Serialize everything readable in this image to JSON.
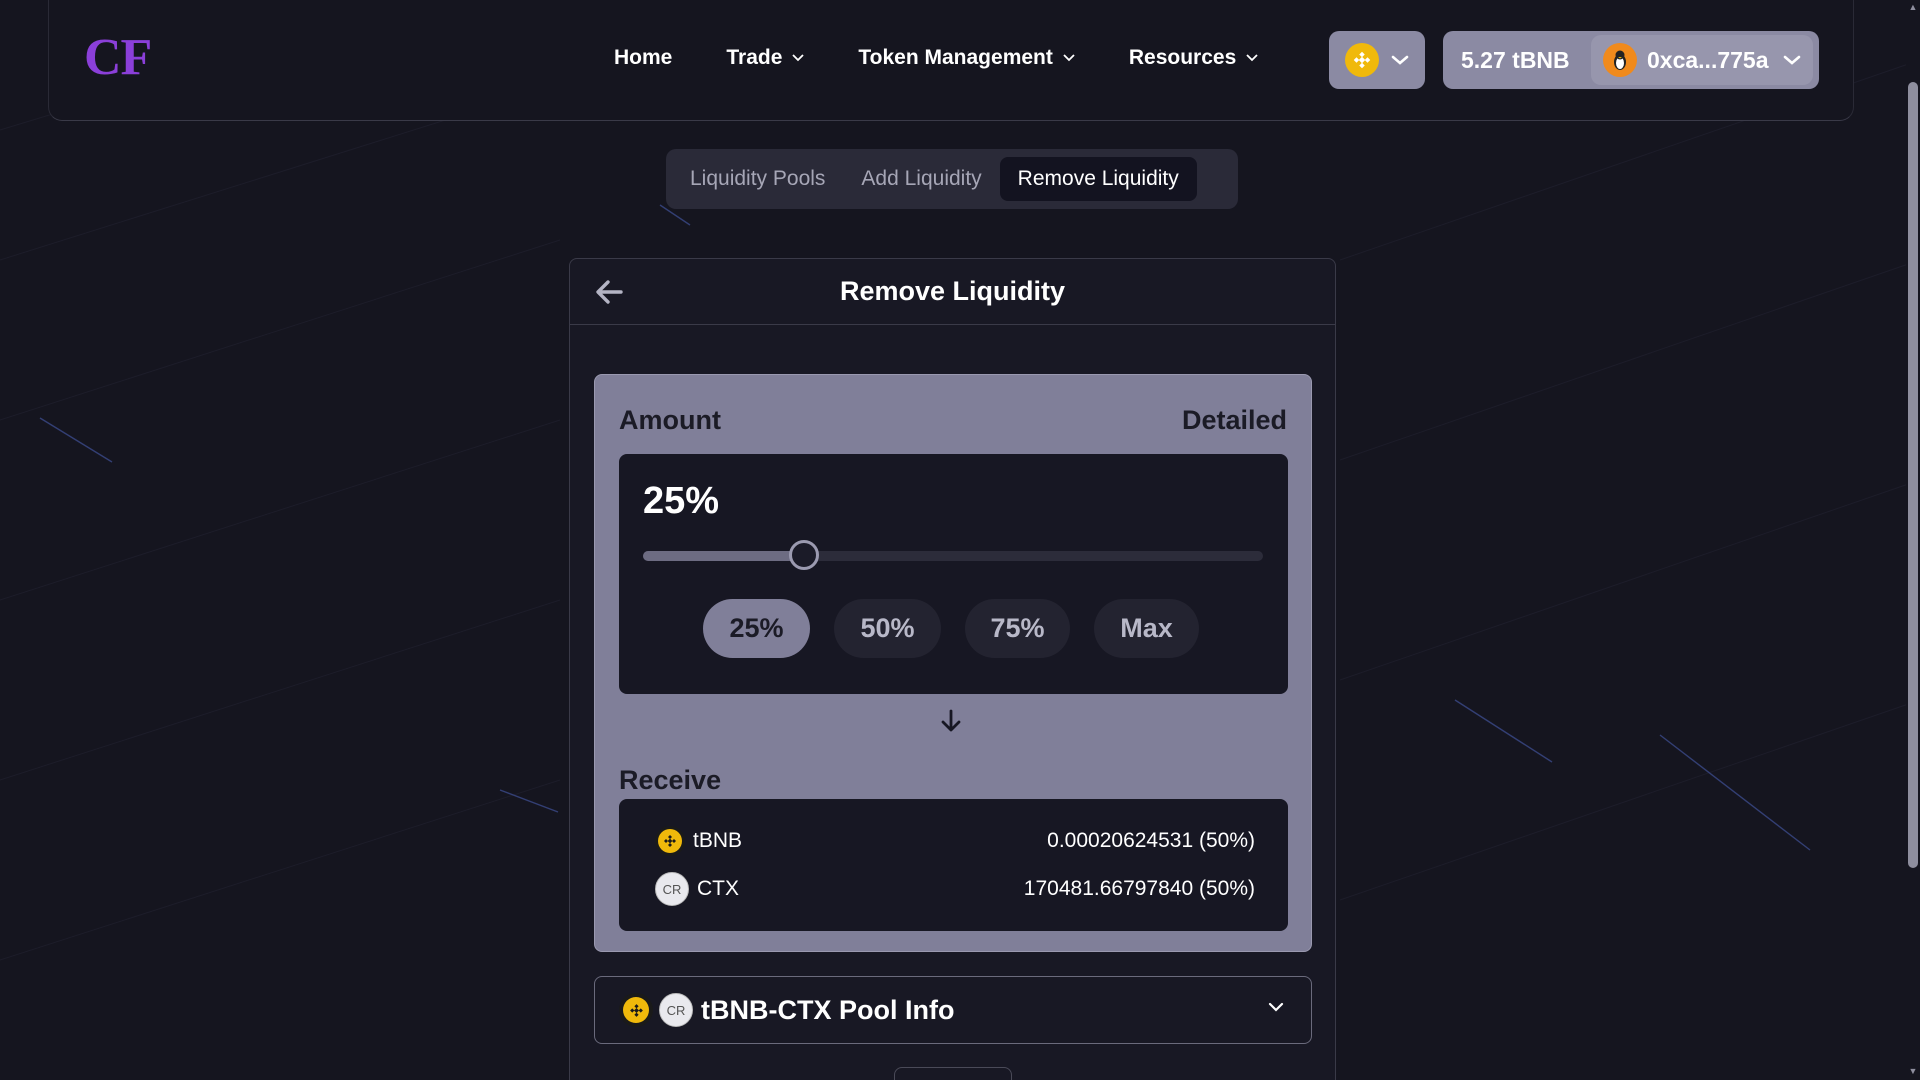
{
  "header": {
    "logo": "CF",
    "nav": [
      {
        "label": "Home",
        "has_dropdown": false
      },
      {
        "label": "Trade",
        "has_dropdown": true
      },
      {
        "label": "Token Management",
        "has_dropdown": true
      },
      {
        "label": "Resources",
        "has_dropdown": true
      }
    ],
    "chain_icon": "bnb-chain-icon",
    "wallet": {
      "balance": "5.27 tBNB",
      "address": "0xca...775a"
    }
  },
  "tabs": {
    "items": [
      "Liquidity Pools",
      "Add Liquidity",
      "Remove Liquidity"
    ],
    "active": "Remove Liquidity"
  },
  "card": {
    "title": "Remove Liquidity",
    "amount_label": "Amount",
    "detailed_label": "Detailed",
    "percent_display": "25%",
    "slider_value": 0.26,
    "quick_buttons": [
      "25%",
      "50%",
      "75%",
      "Max"
    ],
    "quick_active": "25%",
    "receive_label": "Receive",
    "receive": [
      {
        "symbol": "tBNB",
        "amount": "0.00020624531 (50%)",
        "icon": "bnb-icon"
      },
      {
        "symbol": "CTX",
        "amount": "170481.66797840 (50%)",
        "icon": "cr-token-icon",
        "icon_text": "CR"
      }
    ],
    "pool_info_title": "tBNB-CTX Pool Info"
  },
  "colors": {
    "background": "#15151f",
    "logo": "#8b3fd9",
    "panel": "#807f99",
    "inner_box": "#171723",
    "bnb": "#f0b90b"
  }
}
